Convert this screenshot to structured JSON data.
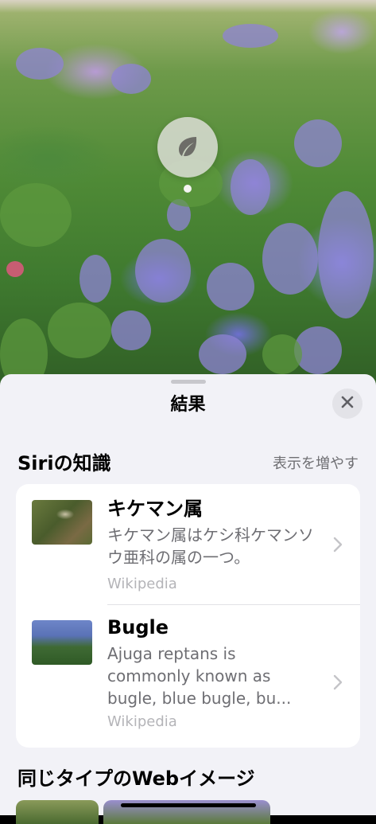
{
  "sheet": {
    "title": "結果"
  },
  "siri_knowledge": {
    "title": "Siriの知識",
    "show_more": "表示を増やす",
    "results": [
      {
        "title": "キケマン属",
        "description": "キケマン属はケシ科ケマンソウ亜科の属の一つ。",
        "source": "Wikipedia"
      },
      {
        "title": "Bugle",
        "description": "Ajuga reptans is commonly known as bugle, blue bugle, bu...",
        "source": "Wikipedia"
      }
    ]
  },
  "web_images": {
    "title": "同じタイプのWebイメージ"
  },
  "icons": {
    "lookup": "leaf-icon",
    "close": "close-icon",
    "chevron": "chevron-right-icon"
  },
  "colors": {
    "sheet_background": "#f2f2f7",
    "card_background": "#ffffff",
    "secondary_text": "#6e6e73",
    "tertiary_text": "#b4b4b8"
  }
}
